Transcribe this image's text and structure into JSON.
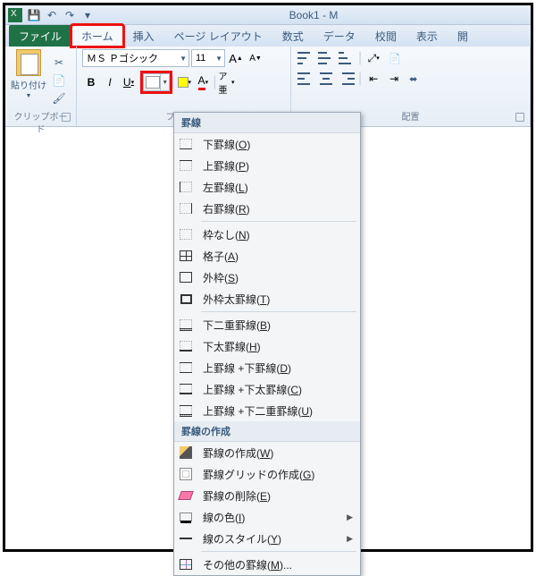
{
  "title": "Book1 - M",
  "qat": {
    "save": "💾",
    "undo": "↶",
    "redo": "↷",
    "custom": "▾"
  },
  "tabs": {
    "file": "ファイル",
    "home": "ホーム",
    "insert": "挿入",
    "pagelayout": "ページ レイアウト",
    "formulas": "数式",
    "data": "データ",
    "review": "校閲",
    "view": "表示",
    "dev": "開"
  },
  "ribbon": {
    "clipboard": {
      "paste": "貼り付け",
      "label": "クリップボード"
    },
    "font": {
      "name": "ＭＳ Ｐゴシック",
      "size": "11",
      "grow": "A",
      "shrink": "A",
      "bold": "B",
      "italic": "I",
      "underline": "U",
      "label": "フォント",
      "fontcolor": "A",
      "furigana": "ア亜"
    },
    "alignment": {
      "label": "配置"
    }
  },
  "menu": {
    "header1": "罫線",
    "bottom": "下罫線(O)",
    "top": "上罫線(P)",
    "left": "左罫線(L)",
    "right": "右罫線(R)",
    "none": "枠なし(N)",
    "grid": "格子(A)",
    "outside": "外枠(S)",
    "thickout": "外枠太罫線(T)",
    "dblbottom": "下二重罫線(B)",
    "thbottom": "下太罫線(H)",
    "tb": "上罫線 +下罫線(D)",
    "tbthick": "上罫線 +下太罫線(C)",
    "tbdbl": "上罫線 +下二重罫線(U)",
    "header2": "罫線の作成",
    "draw": "罫線の作成(W)",
    "drawgrid": "罫線グリッドの作成(G)",
    "erase": "罫線の削除(E)",
    "color": "線の色(I)",
    "style": "線のスタイル(Y)",
    "more": "その他の罫線(M)..."
  }
}
